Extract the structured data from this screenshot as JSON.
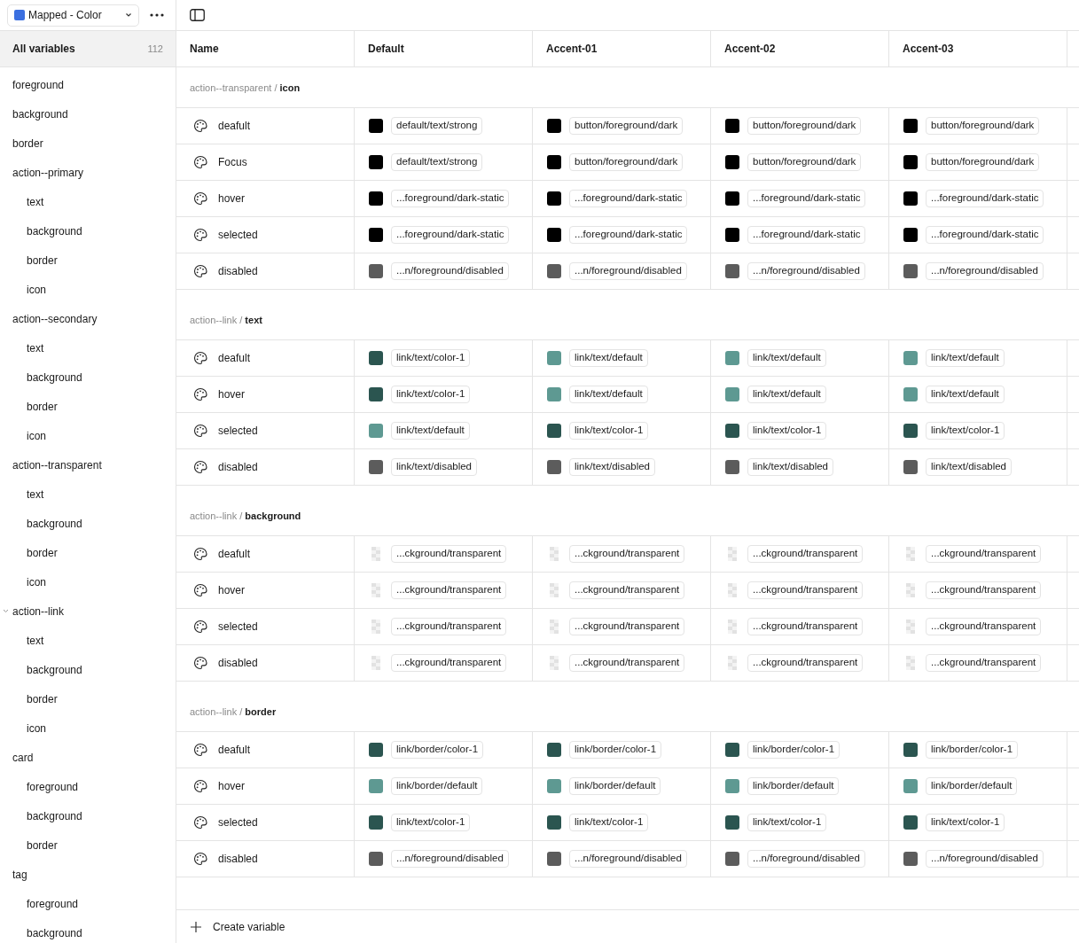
{
  "collection": {
    "label": "Mapped - Color",
    "color": "#3b6fe0"
  },
  "sidebar": {
    "all": {
      "label": "All variables",
      "count": "112",
      "selected": true
    },
    "items": [
      {
        "label": "foreground",
        "expanded": false
      },
      {
        "label": "background",
        "expanded": false
      },
      {
        "label": "border",
        "expanded": false
      },
      {
        "label": "action--primary",
        "expanded": false,
        "children": [
          {
            "label": "text"
          },
          {
            "label": "background"
          },
          {
            "label": "border"
          },
          {
            "label": "icon"
          }
        ]
      },
      {
        "label": "action--secondary",
        "expanded": false,
        "children": [
          {
            "label": "text"
          },
          {
            "label": "background"
          },
          {
            "label": "border"
          },
          {
            "label": "icon"
          }
        ]
      },
      {
        "label": "action--transparent",
        "expanded": false,
        "children": [
          {
            "label": "text"
          },
          {
            "label": "background"
          },
          {
            "label": "border"
          },
          {
            "label": "icon"
          }
        ]
      },
      {
        "label": "action--link",
        "expanded": true,
        "children": [
          {
            "label": "text"
          },
          {
            "label": "background"
          },
          {
            "label": "border"
          },
          {
            "label": "icon"
          }
        ]
      },
      {
        "label": "card",
        "expanded": false,
        "children": [
          {
            "label": "foreground"
          },
          {
            "label": "background"
          },
          {
            "label": "border"
          }
        ]
      },
      {
        "label": "tag",
        "expanded": false,
        "children": [
          {
            "label": "foreground"
          },
          {
            "label": "background"
          }
        ]
      }
    ]
  },
  "table": {
    "columns": [
      "Name",
      "Default",
      "Accent-01",
      "Accent-02",
      "Accent-03"
    ],
    "groups": [
      {
        "heading": "action--transparent / **icon**",
        "rows": [
          {
            "name": "deafult",
            "cells": [
              {
                "kind": "color",
                "color": "#000000",
                "value": "default/text/strong"
              },
              {
                "kind": "color",
                "color": "#000000",
                "value": "button/foreground/dark"
              },
              {
                "kind": "color",
                "color": "#000000",
                "value": "button/foreground/dark"
              },
              {
                "kind": "color",
                "color": "#000000",
                "value": "button/foreground/dark"
              }
            ]
          },
          {
            "name": "Focus",
            "cells": [
              {
                "kind": "color",
                "color": "#000000",
                "value": "default/text/strong"
              },
              {
                "kind": "color",
                "color": "#000000",
                "value": "button/foreground/dark"
              },
              {
                "kind": "color",
                "color": "#000000",
                "value": "button/foreground/dark"
              },
              {
                "kind": "color",
                "color": "#000000",
                "value": "button/foreground/dark"
              }
            ]
          },
          {
            "name": "hover",
            "cells": [
              {
                "kind": "color",
                "color": "#000000",
                "value": "...foreground/dark-static"
              },
              {
                "kind": "color",
                "color": "#000000",
                "value": "...foreground/dark-static"
              },
              {
                "kind": "color",
                "color": "#000000",
                "value": "...foreground/dark-static"
              },
              {
                "kind": "color",
                "color": "#000000",
                "value": "...foreground/dark-static"
              }
            ]
          },
          {
            "name": "selected",
            "cells": [
              {
                "kind": "color",
                "color": "#000000",
                "value": "...foreground/dark-static"
              },
              {
                "kind": "color",
                "color": "#000000",
                "value": "...foreground/dark-static"
              },
              {
                "kind": "color",
                "color": "#000000",
                "value": "...foreground/dark-static"
              },
              {
                "kind": "color",
                "color": "#000000",
                "value": "...foreground/dark-static"
              }
            ]
          },
          {
            "name": "disabled",
            "cells": [
              {
                "kind": "color",
                "color": "#5c5c5c",
                "value": "...n/foreground/disabled"
              },
              {
                "kind": "color",
                "color": "#5c5c5c",
                "value": "...n/foreground/disabled"
              },
              {
                "kind": "color",
                "color": "#5c5c5c",
                "value": "...n/foreground/disabled"
              },
              {
                "kind": "color",
                "color": "#5c5c5c",
                "value": "...n/foreground/disabled"
              }
            ]
          }
        ]
      },
      {
        "heading": "action--link / **text**",
        "rows": [
          {
            "name": "deafult",
            "cells": [
              {
                "kind": "color",
                "color": "#2b5550",
                "value": "link/text/color-1"
              },
              {
                "kind": "color",
                "color": "#5e9992",
                "value": "link/text/default"
              },
              {
                "kind": "color",
                "color": "#5e9992",
                "value": "link/text/default"
              },
              {
                "kind": "color",
                "color": "#5e9992",
                "value": "link/text/default"
              }
            ]
          },
          {
            "name": "hover",
            "cells": [
              {
                "kind": "color",
                "color": "#2b5550",
                "value": "link/text/color-1"
              },
              {
                "kind": "color",
                "color": "#5e9992",
                "value": "link/text/default"
              },
              {
                "kind": "color",
                "color": "#5e9992",
                "value": "link/text/default"
              },
              {
                "kind": "color",
                "color": "#5e9992",
                "value": "link/text/default"
              }
            ]
          },
          {
            "name": "selected",
            "cells": [
              {
                "kind": "color",
                "color": "#5e9992",
                "value": "link/text/default"
              },
              {
                "kind": "color",
                "color": "#2b5550",
                "value": "link/text/color-1"
              },
              {
                "kind": "color",
                "color": "#2b5550",
                "value": "link/text/color-1"
              },
              {
                "kind": "color",
                "color": "#2b5550",
                "value": "link/text/color-1"
              }
            ]
          },
          {
            "name": "disabled",
            "cells": [
              {
                "kind": "color",
                "color": "#5c5c5c",
                "value": "link/text/disabled"
              },
              {
                "kind": "color",
                "color": "#5c5c5c",
                "value": "link/text/disabled"
              },
              {
                "kind": "color",
                "color": "#5c5c5c",
                "value": "link/text/disabled"
              },
              {
                "kind": "color",
                "color": "#5c5c5c",
                "value": "link/text/disabled"
              }
            ]
          }
        ]
      },
      {
        "heading": "action--link / **background**",
        "rows": [
          {
            "name": "deafult",
            "cells": [
              {
                "kind": "transparent",
                "value": "...ckground/transparent"
              },
              {
                "kind": "transparent",
                "value": "...ckground/transparent"
              },
              {
                "kind": "transparent",
                "value": "...ckground/transparent"
              },
              {
                "kind": "transparent",
                "value": "...ckground/transparent"
              }
            ]
          },
          {
            "name": "hover",
            "cells": [
              {
                "kind": "transparent",
                "value": "...ckground/transparent"
              },
              {
                "kind": "transparent",
                "value": "...ckground/transparent"
              },
              {
                "kind": "transparent",
                "value": "...ckground/transparent"
              },
              {
                "kind": "transparent",
                "value": "...ckground/transparent"
              }
            ]
          },
          {
            "name": "selected",
            "cells": [
              {
                "kind": "transparent",
                "value": "...ckground/transparent"
              },
              {
                "kind": "transparent",
                "value": "...ckground/transparent"
              },
              {
                "kind": "transparent",
                "value": "...ckground/transparent"
              },
              {
                "kind": "transparent",
                "value": "...ckground/transparent"
              }
            ]
          },
          {
            "name": "disabled",
            "cells": [
              {
                "kind": "transparent",
                "value": "...ckground/transparent"
              },
              {
                "kind": "transparent",
                "value": "...ckground/transparent"
              },
              {
                "kind": "transparent",
                "value": "...ckground/transparent"
              },
              {
                "kind": "transparent",
                "value": "...ckground/transparent"
              }
            ]
          }
        ]
      },
      {
        "heading": "action--link / **border**",
        "rows": [
          {
            "name": "deafult",
            "cells": [
              {
                "kind": "color",
                "color": "#2b5550",
                "value": "link/border/color-1"
              },
              {
                "kind": "color",
                "color": "#2b5550",
                "value": "link/border/color-1"
              },
              {
                "kind": "color",
                "color": "#2b5550",
                "value": "link/border/color-1"
              },
              {
                "kind": "color",
                "color": "#2b5550",
                "value": "link/border/color-1"
              }
            ]
          },
          {
            "name": "hover",
            "cells": [
              {
                "kind": "color",
                "color": "#5e9992",
                "value": "link/border/default"
              },
              {
                "kind": "color",
                "color": "#5e9992",
                "value": "link/border/default"
              },
              {
                "kind": "color",
                "color": "#5e9992",
                "value": "link/border/default"
              },
              {
                "kind": "color",
                "color": "#5e9992",
                "value": "link/border/default"
              }
            ]
          },
          {
            "name": "selected",
            "cells": [
              {
                "kind": "color",
                "color": "#2b5550",
                "value": "link/text/color-1"
              },
              {
                "kind": "color",
                "color": "#2b5550",
                "value": "link/text/color-1"
              },
              {
                "kind": "color",
                "color": "#2b5550",
                "value": "link/text/color-1"
              },
              {
                "kind": "color",
                "color": "#2b5550",
                "value": "link/text/color-1"
              }
            ]
          },
          {
            "name": "disabled",
            "cells": [
              {
                "kind": "color",
                "color": "#5c5c5c",
                "value": "...n/foreground/disabled"
              },
              {
                "kind": "color",
                "color": "#5c5c5c",
                "value": "...n/foreground/disabled"
              },
              {
                "kind": "color",
                "color": "#5c5c5c",
                "value": "...n/foreground/disabled"
              },
              {
                "kind": "color",
                "color": "#5c5c5c",
                "value": "...n/foreground/disabled"
              }
            ]
          }
        ]
      }
    ]
  },
  "footer": {
    "label": "Create variable"
  }
}
